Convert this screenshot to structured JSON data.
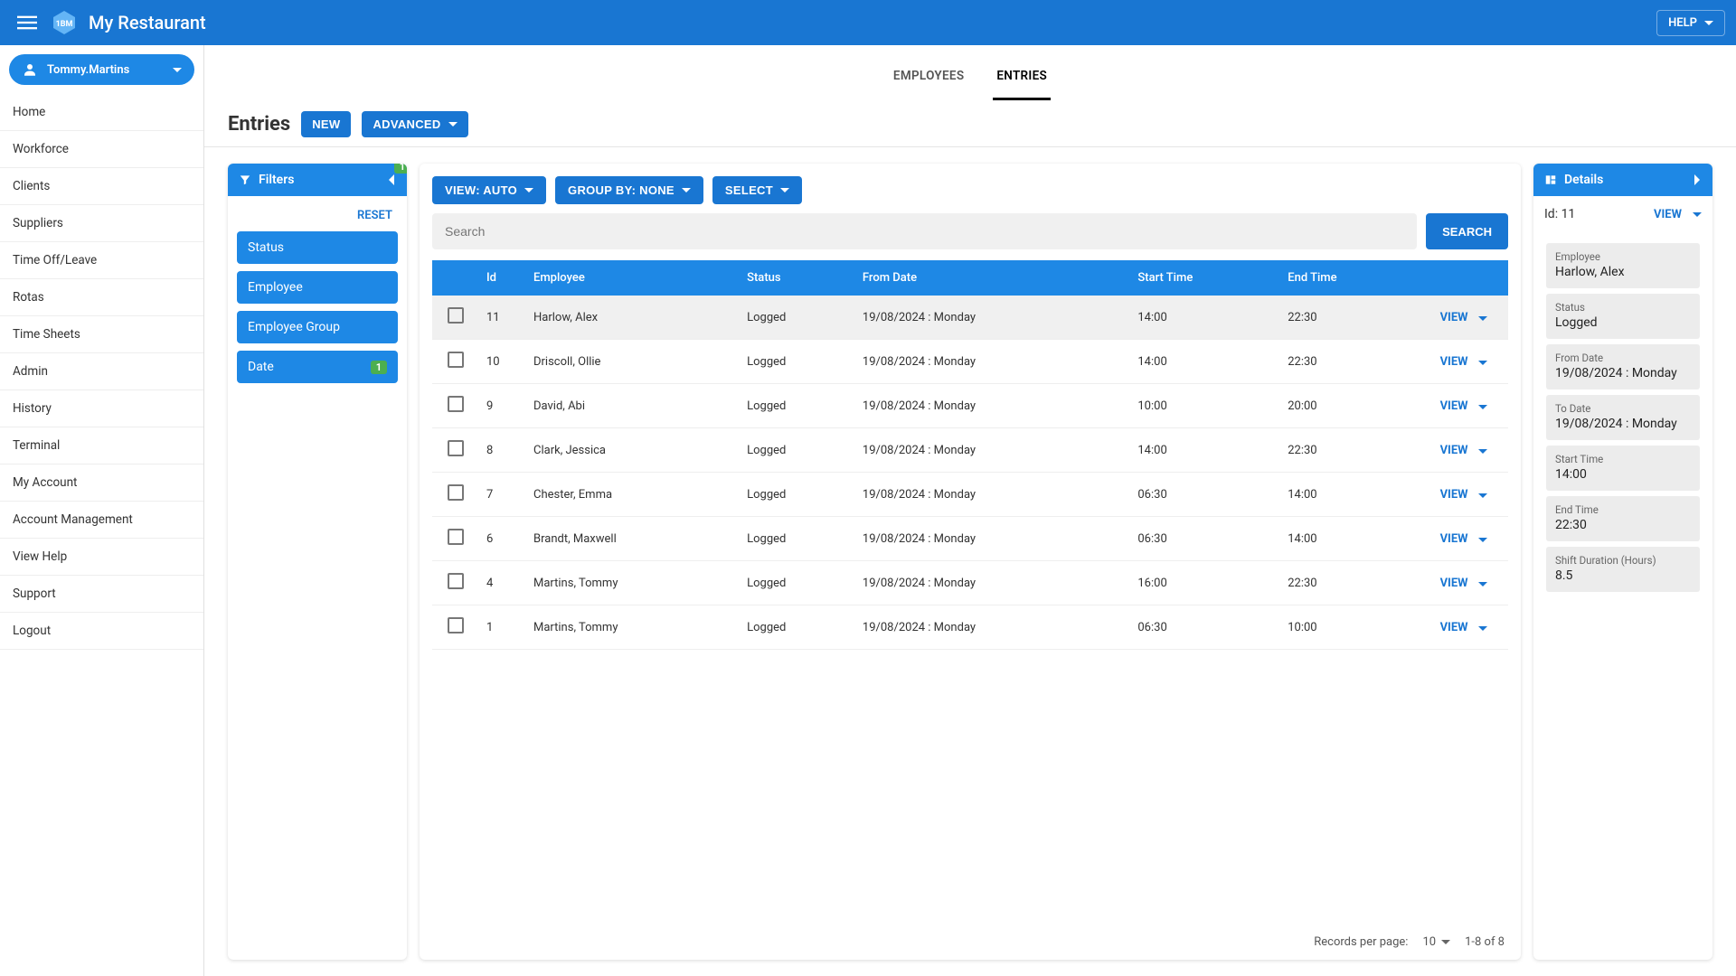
{
  "app": {
    "title": "My Restaurant",
    "help_label": "HELP"
  },
  "user": {
    "name": "Tommy.Martins"
  },
  "nav": {
    "items": [
      "Home",
      "Workforce",
      "Clients",
      "Suppliers",
      "Time Off/Leave",
      "Rotas",
      "Time Sheets",
      "Admin",
      "History",
      "Terminal",
      "My Account",
      "Account Management",
      "View Help",
      "Support",
      "Logout"
    ]
  },
  "tabs": {
    "employees": "EMPLOYEES",
    "entries": "ENTRIES"
  },
  "page": {
    "title": "Entries",
    "new_btn": "NEW",
    "advanced_btn": "ADVANCED"
  },
  "filters": {
    "title": "Filters",
    "badge": "1",
    "reset": "RESET",
    "items": [
      {
        "label": "Status",
        "count": null
      },
      {
        "label": "Employee",
        "count": null
      },
      {
        "label": "Employee Group",
        "count": null
      },
      {
        "label": "Date",
        "count": "1"
      }
    ]
  },
  "toolbar": {
    "view": "VIEW: AUTO",
    "group": "GROUP BY: NONE",
    "select": "SELECT"
  },
  "search": {
    "placeholder": "Search",
    "button": "SEARCH"
  },
  "table": {
    "headers": {
      "id": "Id",
      "employee": "Employee",
      "status": "Status",
      "from": "From Date",
      "start": "Start Time",
      "end": "End Time"
    },
    "view_label": "VIEW",
    "rows": [
      {
        "id": "11",
        "employee": "Harlow, Alex",
        "status": "Logged",
        "from": "19/08/2024 : Monday",
        "start": "14:00",
        "end": "22:30",
        "selected": true
      },
      {
        "id": "10",
        "employee": "Driscoll, Ollie",
        "status": "Logged",
        "from": "19/08/2024 : Monday",
        "start": "14:00",
        "end": "22:30"
      },
      {
        "id": "9",
        "employee": "David, Abi",
        "status": "Logged",
        "from": "19/08/2024 : Monday",
        "start": "10:00",
        "end": "20:00"
      },
      {
        "id": "8",
        "employee": "Clark, Jessica",
        "status": "Logged",
        "from": "19/08/2024 : Monday",
        "start": "14:00",
        "end": "22:30"
      },
      {
        "id": "7",
        "employee": "Chester, Emma",
        "status": "Logged",
        "from": "19/08/2024 : Monday",
        "start": "06:30",
        "end": "14:00"
      },
      {
        "id": "6",
        "employee": "Brandt, Maxwell",
        "status": "Logged",
        "from": "19/08/2024 : Monday",
        "start": "06:30",
        "end": "14:00"
      },
      {
        "id": "4",
        "employee": "Martins, Tommy",
        "status": "Logged",
        "from": "19/08/2024 : Monday",
        "start": "16:00",
        "end": "22:30"
      },
      {
        "id": "1",
        "employee": "Martins, Tommy",
        "status": "Logged",
        "from": "19/08/2024 : Monday",
        "start": "06:30",
        "end": "10:00"
      }
    ],
    "footer": {
      "per_page_label": "Records per page:",
      "per_page_value": "10",
      "range": "1-8 of 8"
    }
  },
  "details": {
    "title": "Details",
    "id_label": "Id: 11",
    "view": "VIEW",
    "cards": [
      {
        "k": "Employee",
        "v": "Harlow, Alex"
      },
      {
        "k": "Status",
        "v": "Logged"
      },
      {
        "k": "From Date",
        "v": "19/08/2024 : Monday"
      },
      {
        "k": "To Date",
        "v": "19/08/2024 : Monday"
      },
      {
        "k": "Start Time",
        "v": "14:00"
      },
      {
        "k": "End Time",
        "v": "22:30"
      },
      {
        "k": "Shift Duration (Hours)",
        "v": "8.5"
      }
    ]
  }
}
